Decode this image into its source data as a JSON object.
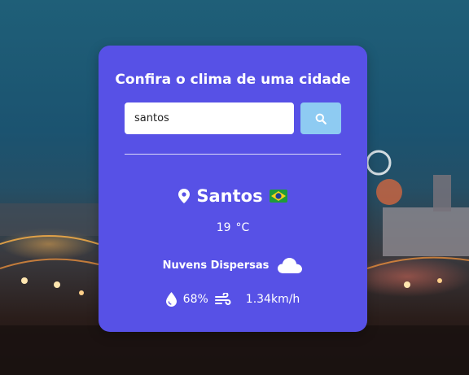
{
  "app": {
    "heading": "Confira o clima de uma cidade"
  },
  "search": {
    "value": "santos",
    "button_icon": "search-icon"
  },
  "weather": {
    "city": "Santos",
    "country_flag_icon": "brazil-flag-icon",
    "temperature": "19",
    "unit": "°C",
    "description": "Nuvens Dispersas",
    "condition_icon": "cloud-icon",
    "humidity": "68%",
    "wind": "1.34km/h"
  },
  "colors": {
    "card": "#5751e6",
    "search_button": "#8ecbf2"
  }
}
